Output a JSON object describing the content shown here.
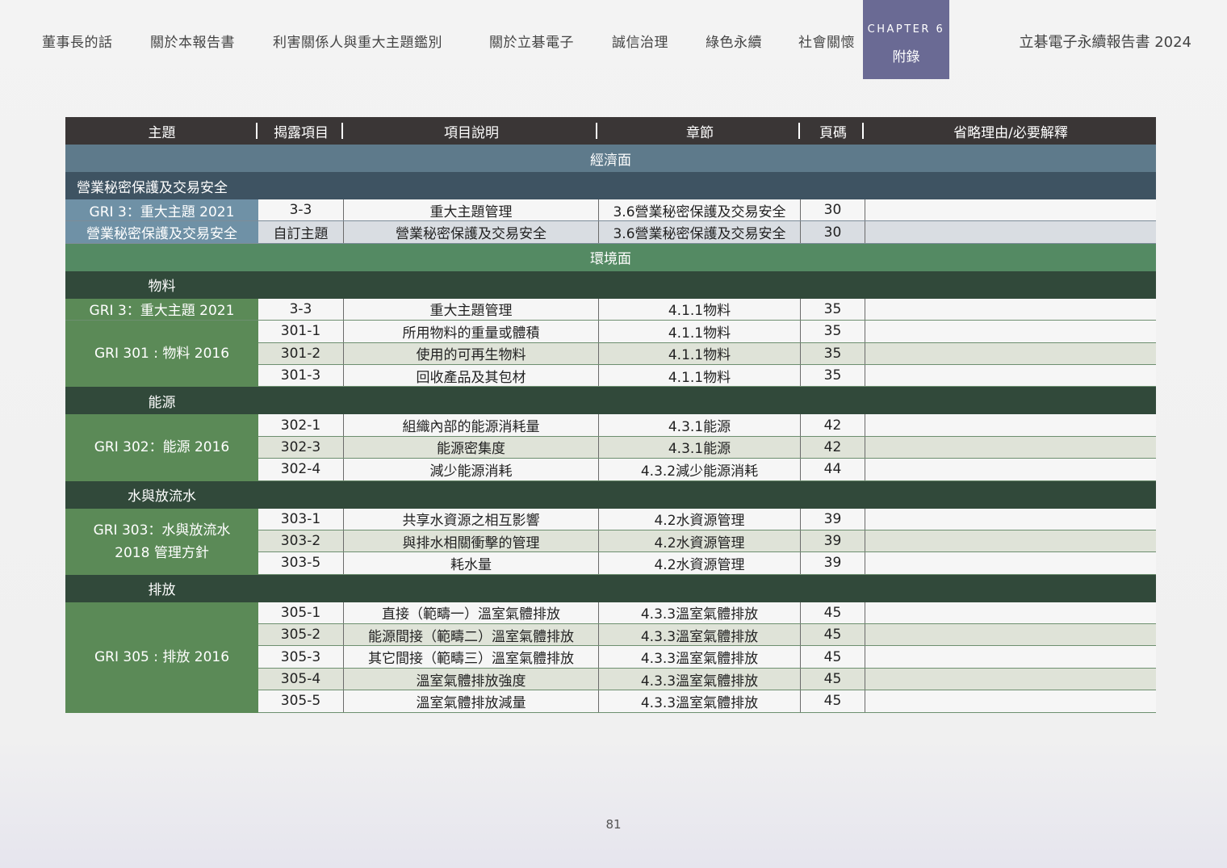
{
  "nav": {
    "items": [
      "董事長的話",
      "關於本報告書",
      "利害關係人與重大主題鑑別",
      "關於立碁電子",
      "誠信治理",
      "綠色永續",
      "社會關懷"
    ],
    "chapter": "CHAPTER 6",
    "chapter_label": "附錄",
    "report_title": "立碁電子永續報告書 2024"
  },
  "table": {
    "headers": [
      "主題",
      "揭露項目",
      "項目說明",
      "章節",
      "頁碼",
      "省略理由/必要解釋"
    ],
    "econ_band": "經濟面",
    "econ_sub": "營業秘密保護及交易安全",
    "econ_rows": [
      {
        "topic": "GRI 3：重大主題 2021",
        "item": "3-3",
        "desc": "重大主題管理",
        "section": "3.6營業秘密保護及交易安全",
        "page": "30"
      },
      {
        "topic": "營業秘密保護及交易安全",
        "item": "自訂主題",
        "desc": "營業秘密保護及交易安全",
        "section": "3.6營業秘密保護及交易安全",
        "page": "30"
      }
    ],
    "env_band": "環境面",
    "sections": [
      {
        "title": "物料",
        "single": {
          "topic": "GRI 3：重大主題 2021",
          "item": "3-3",
          "desc": "重大主題管理",
          "section": "4.1.1物料",
          "page": "35"
        },
        "group_label": [
          "GRI 301 : 物料 2016"
        ],
        "rows": [
          {
            "item": "301-1",
            "desc": "所用物料的重量或體積",
            "section": "4.1.1物料",
            "page": "35"
          },
          {
            "item": "301-2",
            "desc": "使用的可再生物料",
            "section": "4.1.1物料",
            "page": "35"
          },
          {
            "item": "301-3",
            "desc": "回收產品及其包材",
            "section": "4.1.1物料",
            "page": "35"
          }
        ]
      },
      {
        "title": "能源",
        "group_label": [
          "GRI 302：能源 2016"
        ],
        "rows": [
          {
            "item": "302-1",
            "desc": "組織內部的能源消耗量",
            "section": "4.3.1能源",
            "page": "42"
          },
          {
            "item": "302-3",
            "desc": "能源密集度",
            "section": "4.3.1能源",
            "page": "42"
          },
          {
            "item": "302-4",
            "desc": "減少能源消耗",
            "section": "4.3.2減少能源消耗",
            "page": "44"
          }
        ]
      },
      {
        "title": "水與放流水",
        "group_label": [
          "GRI 303：水與放流水",
          "2018 管理方針"
        ],
        "rows": [
          {
            "item": "303-1",
            "desc": "共享水資源之相互影響",
            "section": "4.2水資源管理",
            "page": "39"
          },
          {
            "item": "303-2",
            "desc": "與排水相關衝擊的管理",
            "section": "4.2水資源管理",
            "page": "39"
          },
          {
            "item": "303-5",
            "desc": "耗水量",
            "section": "4.2水資源管理",
            "page": "39"
          }
        ]
      },
      {
        "title": "排放",
        "group_label": [
          "GRI 305 : 排放 2016"
        ],
        "rows": [
          {
            "item": "305-1",
            "desc": "直接（範疇一）溫室氣體排放",
            "section": "4.3.3溫室氣體排放",
            "page": "45"
          },
          {
            "item": "305-2",
            "desc": "能源間接（範疇二）溫室氣體排放",
            "section": "4.3.3溫室氣體排放",
            "page": "45"
          },
          {
            "item": "305-3",
            "desc": "其它間接（範疇三）溫室氣體排放",
            "section": "4.3.3溫室氣體排放",
            "page": "45"
          },
          {
            "item": "305-4",
            "desc": "溫室氣體排放強度",
            "section": "4.3.3溫室氣體排放",
            "page": "45"
          },
          {
            "item": "305-5",
            "desc": "溫室氣體排放減量",
            "section": "4.3.3溫室氣體排放",
            "page": "45"
          }
        ]
      }
    ]
  },
  "footer": {
    "page_number": "81"
  },
  "colors": {
    "header": "#3a3636",
    "econ": "#5e7a8b",
    "env": "#548a63",
    "env_sub": "#31493a",
    "chapter": "#6a6a94"
  }
}
